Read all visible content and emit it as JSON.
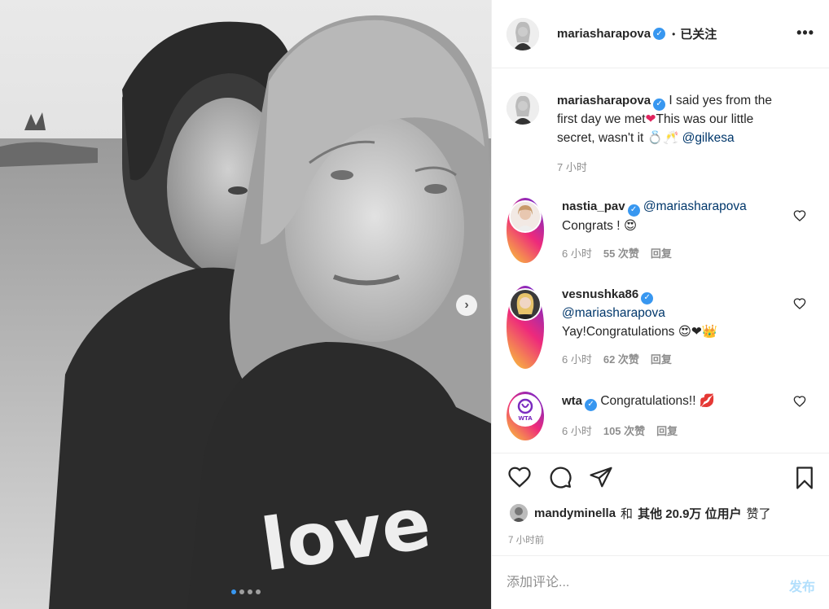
{
  "post": {
    "carousel_dots": 4,
    "active_dot": 0,
    "next_arrow": "›"
  },
  "header": {
    "username": "mariasharapova",
    "verified_mark": "✓",
    "separator": "•",
    "follow_status": "已关注",
    "more": "•••"
  },
  "caption": {
    "username": "mariasharapova",
    "text_part1": "I said yes from the first day we met",
    "heart": "❤",
    "text_part2": "This was our little secret, wasn't it",
    "ring_emoji": "💍",
    "toast_emoji": "🥂",
    "mention": "@gilkesa",
    "time": "7 小时"
  },
  "comments": [
    {
      "username": "nastia_pav",
      "mention": "@mariasharapova",
      "text": "Congrats !",
      "emoji": "😍",
      "time": "6 小时",
      "likes": "55 次赞",
      "reply": "回复"
    },
    {
      "username": "vesnushka86",
      "mention": "@mariasharapova",
      "text": "Yay!Congratulations",
      "emoji": "😍❤👑",
      "time": "6 小时",
      "likes": "62 次赞",
      "reply": "回复"
    },
    {
      "username": "wta",
      "text": "Congratulations!!",
      "emoji": "💋",
      "time": "6 小时",
      "likes": "105 次赞",
      "reply": "回复",
      "avatar_text": "WTA"
    }
  ],
  "likes_line": {
    "user": "mandyminella",
    "and": "和",
    "others": "其他 20.9万 位用户",
    "suffix": "赞了"
  },
  "timestamp": "7 小时前",
  "composer": {
    "placeholder": "添加评论...",
    "post_label": "发布"
  },
  "photo_text": "love",
  "icons": {
    "like": "heart-icon",
    "comment": "comment-icon",
    "share": "share-icon",
    "save": "bookmark-icon"
  },
  "colors": {
    "verified": "#3897f0",
    "mention": "#00376b",
    "muted": "#8e8e8e",
    "post_disabled": "#b2dffc"
  }
}
